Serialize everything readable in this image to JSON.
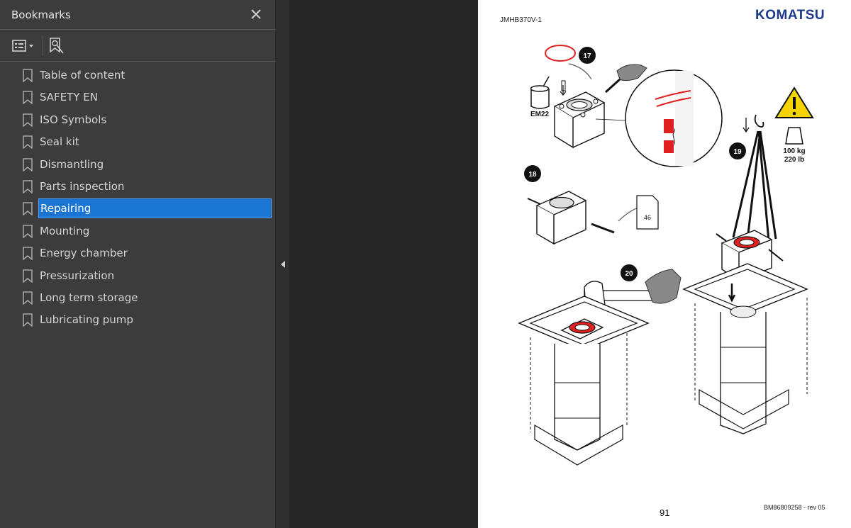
{
  "sidebar": {
    "title": "Bookmarks",
    "items": [
      {
        "label": "Table of content"
      },
      {
        "label": "SAFETY EN"
      },
      {
        "label": "ISO Symbols"
      },
      {
        "label": "Seal kit"
      },
      {
        "label": "Dismantling"
      },
      {
        "label": "Parts inspection"
      },
      {
        "label": "Repairing",
        "selected": true
      },
      {
        "label": "Mounting"
      },
      {
        "label": "Energy chamber"
      },
      {
        "label": "Pressurization"
      },
      {
        "label": "Long term storage"
      },
      {
        "label": "Lubricating pump"
      }
    ]
  },
  "page": {
    "doc_code": "JMHB370V-1",
    "brand": "KOMATSU",
    "page_number": "91",
    "revision": "BM86809258 - rev 05",
    "steps": [
      "17",
      "18",
      "19",
      "20"
    ],
    "labels": {
      "grease": "EM22",
      "weight_kg": "100 kg",
      "weight_lb": "220 lb",
      "page_ref": "46"
    }
  },
  "colors": {
    "selection": "#1a76d2",
    "seal_red": "#e02020",
    "warning_yellow": "#f5d400",
    "brand_blue": "#1b3a8a"
  }
}
